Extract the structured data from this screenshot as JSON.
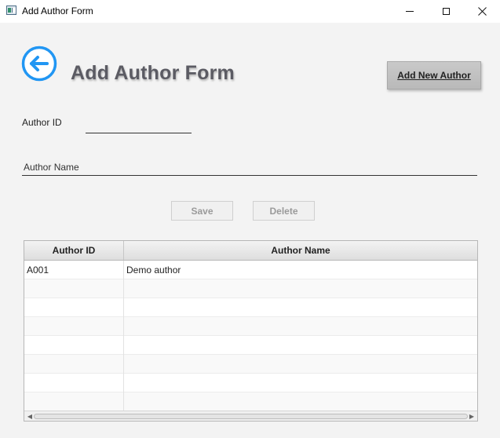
{
  "window": {
    "title": "Add Author Form",
    "controls": [
      "minimize",
      "maximize",
      "close"
    ]
  },
  "header": {
    "back_icon": "arrow-left-circle-icon",
    "title": "Add Author Form",
    "add_new_label": "Add New Author",
    "accent_color": "#2196f3"
  },
  "form": {
    "author_id_label": "Author ID",
    "author_id_value": "",
    "author_name_placeholder": "Author Name",
    "author_name_value": ""
  },
  "actions": {
    "save_label": "Save",
    "delete_label": "Delete"
  },
  "table": {
    "columns": [
      "Author ID",
      "Author Name"
    ],
    "rows": [
      [
        "A001",
        "Demo author"
      ],
      [
        "",
        ""
      ],
      [
        "",
        ""
      ],
      [
        "",
        ""
      ],
      [
        "",
        ""
      ],
      [
        "",
        ""
      ],
      [
        "",
        ""
      ],
      [
        "",
        ""
      ]
    ]
  }
}
